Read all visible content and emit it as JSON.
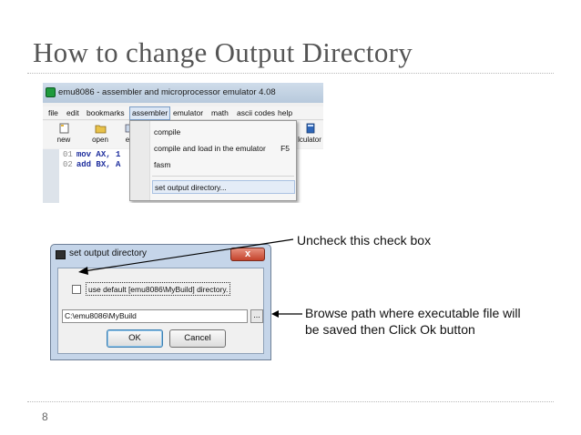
{
  "slide": {
    "title": "How to change Output Directory",
    "page_number": "8"
  },
  "window": {
    "title": "emu8086 - assembler and microprocessor emulator 4.08",
    "menu": [
      "file",
      "edit",
      "bookmarks",
      "assembler",
      "emulator",
      "math",
      "ascii codes",
      "help"
    ],
    "active_menu": "assembler",
    "toolbar": [
      {
        "label": "new",
        "icon": "new-file-icon"
      },
      {
        "label": "open",
        "icon": "open-folder-icon"
      },
      {
        "label": "ex",
        "icon": "examples-icon"
      },
      {
        "label": "lculator",
        "icon": "calculator-icon"
      }
    ],
    "code_lines": [
      {
        "no": "01",
        "text": "mov AX, 1"
      },
      {
        "no": "02",
        "text": "add BX, A"
      }
    ],
    "dropdown": {
      "items": [
        {
          "label": "compile",
          "shortcut": ""
        },
        {
          "label": "compile and load in the emulator",
          "shortcut": "F5"
        },
        {
          "label": "fasm",
          "shortcut": ""
        },
        {
          "label": "set output directory...",
          "shortcut": ""
        }
      ],
      "highlighted": "set output directory..."
    }
  },
  "dialog": {
    "title": "set output directory",
    "close": "x",
    "checkbox_label": "use default [emu8086\\MyBuild] directory.",
    "checkbox_checked": false,
    "path_value": "C:\\emu8086\\MyBuild",
    "browse_label": "...",
    "ok_label": "OK",
    "cancel_label": "Cancel"
  },
  "annotations": {
    "uncheck": "Uncheck this check box",
    "browse_line1": "Browse path where executable file will",
    "browse_line2": "be saved then Click Ok button"
  }
}
